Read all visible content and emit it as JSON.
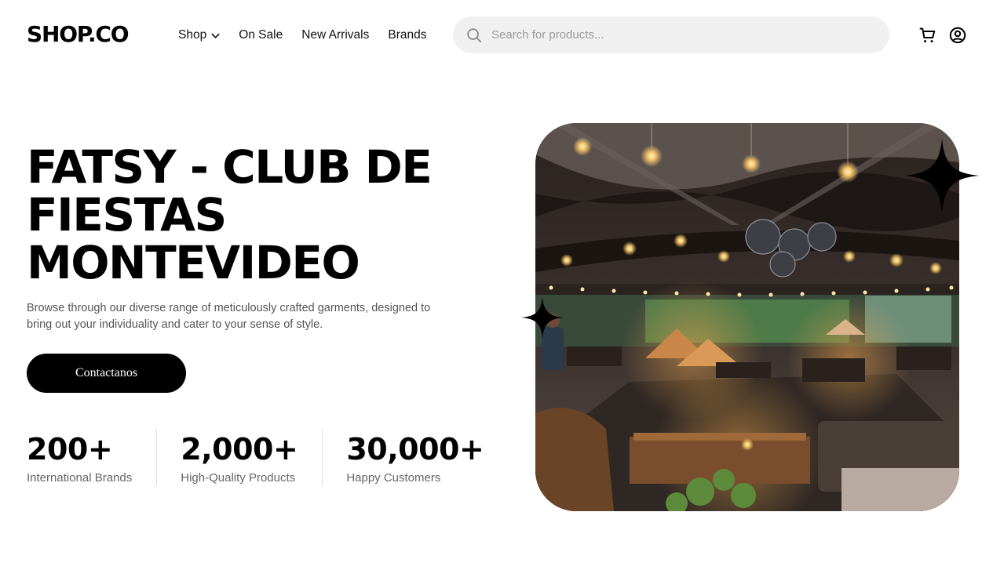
{
  "header": {
    "logo": "SHOP.CO",
    "nav": [
      {
        "label": "Shop"
      },
      {
        "label": "On Sale"
      },
      {
        "label": "New Arrivals"
      },
      {
        "label": "Brands"
      }
    ],
    "search": {
      "placeholder": "Search for products..."
    },
    "icons": [
      "search-icon",
      "cart-icon",
      "account-icon",
      "chevron-down-icon"
    ]
  },
  "hero": {
    "title": "FATSY - CLUB DE FIESTAS MONTEVIDEO",
    "description": "Browse through our diverse range of meticulously crafted garments, designed to bring out your individuality and cater to your sense of style.",
    "cta_label": "Contactanos",
    "stats": [
      {
        "value": "200+",
        "label": "International Brands"
      },
      {
        "value": "2,000+",
        "label": "High-Quality Products"
      },
      {
        "value": "30,000+",
        "label": "Happy Customers"
      }
    ]
  },
  "colors": {
    "primary": "#000000",
    "background": "#ffffff",
    "search_bg": "#f0f0f0",
    "muted_text": "#555555"
  }
}
